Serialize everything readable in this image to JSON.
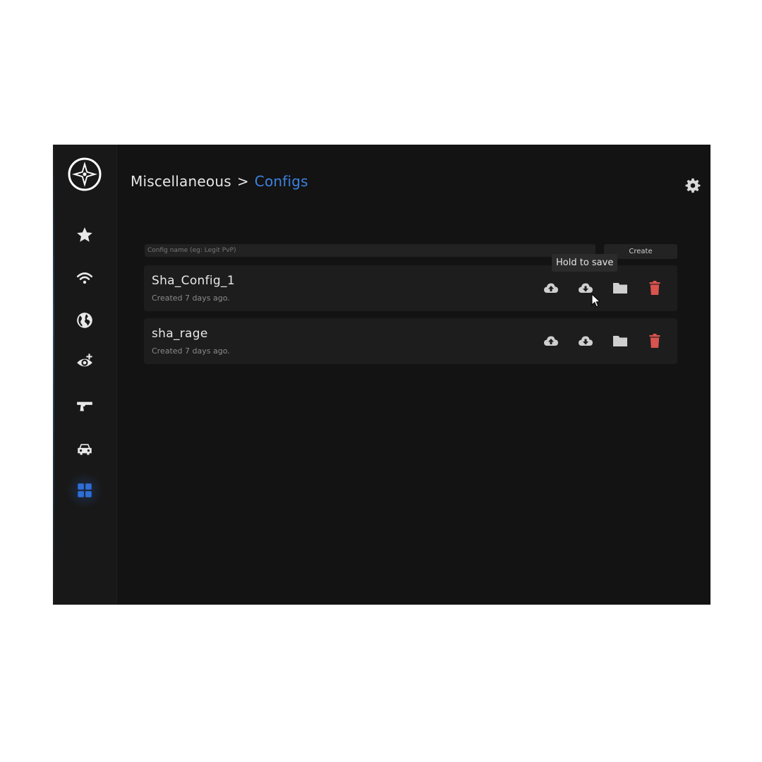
{
  "app": {
    "logo_icon": "logo-star-icon"
  },
  "sidebar": {
    "items": [
      {
        "name": "favorites",
        "icon": "star-icon"
      },
      {
        "name": "network",
        "icon": "wifi-icon"
      },
      {
        "name": "world",
        "icon": "globe-icon"
      },
      {
        "name": "visuals",
        "icon": "eye-plus-icon"
      },
      {
        "name": "weapons",
        "icon": "pistol-icon"
      },
      {
        "name": "vehicles",
        "icon": "car-icon"
      },
      {
        "name": "miscellaneous",
        "icon": "grid-icon",
        "active": true
      }
    ],
    "active_color": "#2e6ed6"
  },
  "header": {
    "section": "Miscellaneous",
    "separator": ">",
    "page": "Configs",
    "page_color": "#3d82e0",
    "settings_icon": "gear-icon"
  },
  "create_form": {
    "placeholder": "Config name (eg: Legit PvP)",
    "value": "",
    "button_label": "Create"
  },
  "configs": [
    {
      "name": "Sha_Config_1",
      "created": "Created 7 days ago."
    },
    {
      "name": "sha_rage",
      "created": "Created 7 days ago."
    }
  ],
  "row_actions": [
    {
      "icon": "cloud-upload-icon"
    },
    {
      "icon": "cloud-download-icon"
    },
    {
      "icon": "folder-icon"
    },
    {
      "icon": "trash-icon",
      "color": "#d9534f"
    }
  ],
  "tooltip": {
    "text": "Hold to save"
  }
}
